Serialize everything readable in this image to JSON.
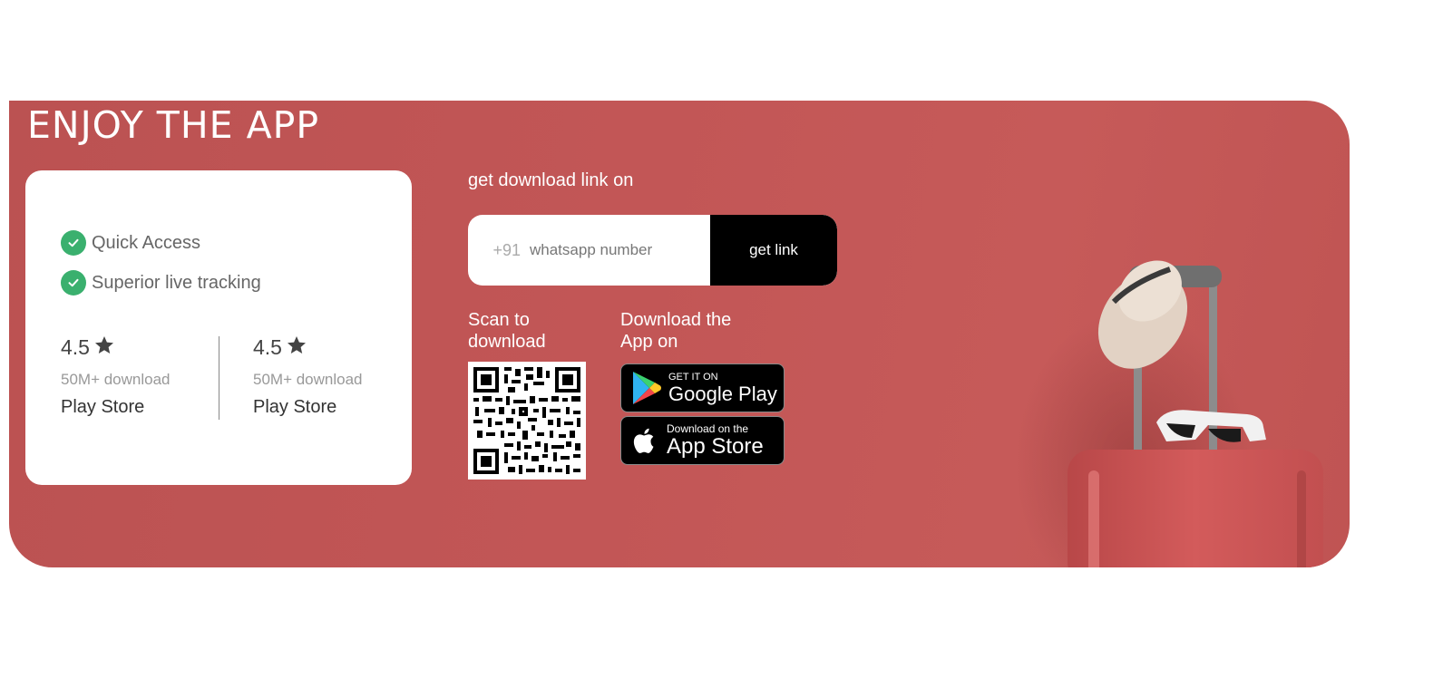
{
  "banner": {
    "title": "ENJOY THE APP",
    "features": [
      {
        "icon": "check-circle-icon",
        "label": "Quick Access"
      },
      {
        "icon": "check-circle-icon",
        "label": "Superior live tracking"
      }
    ],
    "stats": [
      {
        "rating": "4.5",
        "downloads": "50M+ download",
        "store": "Play Store"
      },
      {
        "rating": "4.5",
        "downloads": "50M+ download",
        "store": "Play Store"
      }
    ],
    "link_label": "get download link on",
    "phone_prefix": "+91",
    "phone_placeholder": "whatsapp number",
    "get_link_label": "get link",
    "scan_label": "Scan to download",
    "download_label": "Download the App on",
    "google_play": {
      "small": "GET IT ON",
      "big": "Google Play"
    },
    "app_store": {
      "small": "Download on the",
      "big": "App Store"
    }
  },
  "colors": {
    "banner_red": "#c25656",
    "check_green": "#3ab06e",
    "button_black": "#000000"
  }
}
